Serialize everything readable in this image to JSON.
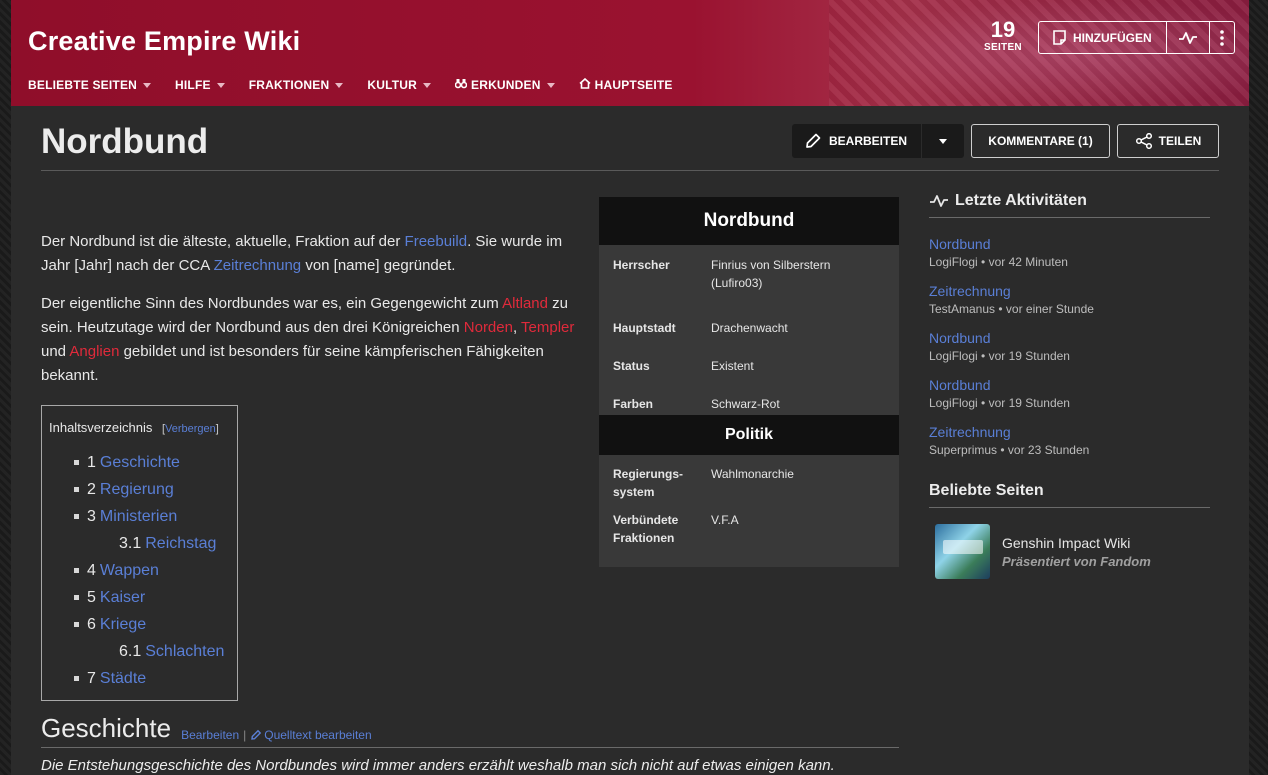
{
  "header": {
    "site_title": "Creative Empire Wiki",
    "nav": [
      {
        "label": "BELIEBTE SEITEN",
        "caret": true
      },
      {
        "label": "HILFE",
        "caret": true
      },
      {
        "label": "FRAKTIONEN",
        "caret": true
      },
      {
        "label": "KULTUR",
        "caret": true
      },
      {
        "label": "ERKUNDEN",
        "caret": true,
        "icon": "binoculars-icon"
      },
      {
        "label": "HAUPTSEITE",
        "caret": false,
        "icon": "home-icon"
      }
    ],
    "pages_count": "19",
    "pages_label": "SEITEN",
    "add_label": "HINZUFÜGEN"
  },
  "page": {
    "title": "Nordbund",
    "edit_label": "BEARBEITEN",
    "comments_label": "KOMMENTARE (1)",
    "share_label": "TEILEN"
  },
  "article": {
    "p1": {
      "a": "Der Nordbund ist die älteste, aktuelle, Fraktion auf der ",
      "link1": "Freebuild",
      "b": ". Sie wurde im Jahr [Jahr] nach der CCA ",
      "link2": "Zeitrechnung",
      "c": " von [name] gegründet."
    },
    "p2": {
      "a": "Der eigentliche Sinn des Nordbundes war es, ein Gegengewicht zum ",
      "link1": "Altland",
      "b": " zu sein. Heutzutage wird der Nordbund aus den drei Königreichen ",
      "link2": "Norden",
      "c": ", ",
      "link3": "Templer",
      "d": " und ",
      "link4": "Anglien",
      "e": " gebildet und ist besonders für seine kämpferischen Fähigkeiten bekannt."
    }
  },
  "toc": {
    "title": "Inhaltsverzeichnis",
    "toggle_open": "[",
    "toggle_label": "Verbergen",
    "toggle_close": "]",
    "items": [
      {
        "num": "1",
        "label": "Geschichte",
        "sub": false
      },
      {
        "num": "2",
        "label": "Regierung",
        "sub": false
      },
      {
        "num": "3",
        "label": "Ministerien",
        "sub": false
      },
      {
        "num": "3.1",
        "label": "Reichstag",
        "sub": true
      },
      {
        "num": "4",
        "label": "Wappen",
        "sub": false
      },
      {
        "num": "5",
        "label": "Kaiser",
        "sub": false
      },
      {
        "num": "6",
        "label": "Kriege",
        "sub": false
      },
      {
        "num": "6.1",
        "label": "Schlachten",
        "sub": true
      },
      {
        "num": "7",
        "label": "Städte",
        "sub": false
      }
    ]
  },
  "section": {
    "heading": "Geschichte",
    "edit": "Bearbeiten",
    "separator": "|",
    "source_edit": "Quelltext bearbeiten",
    "intro": "Die Entstehungsgeschichte des Nordbundes wird immer anders erzählt weshalb man sich nicht auf etwas einigen kann."
  },
  "infobox": {
    "title": "Nordbund",
    "rows": [
      {
        "key": "Herrscher",
        "value": "Finrius von Silberstern (Lufiro03)"
      },
      {
        "key": "Hauptstadt",
        "value": "Drachenwacht"
      },
      {
        "key": "Status",
        "value": "Existent"
      },
      {
        "key": "Farben",
        "value": "Schwarz-Rot"
      }
    ],
    "section2": "Politik",
    "rows2": [
      {
        "key": "Regierungs-system",
        "value": "Wahlmonarchie"
      },
      {
        "key": "Verbündete Fraktionen",
        "value": "V.F.A"
      }
    ]
  },
  "rail": {
    "activity_title": "Letzte Aktivitäten",
    "activities": [
      {
        "title": "Nordbund",
        "meta": "LogiFlogi • vor 42 Minuten"
      },
      {
        "title": "Zeitrechnung",
        "meta": "TestAmanus • vor einer Stunde"
      },
      {
        "title": "Nordbund",
        "meta": "LogiFlogi • vor 19 Stunden"
      },
      {
        "title": "Nordbund",
        "meta": "LogiFlogi • vor 19 Stunden"
      },
      {
        "title": "Zeitrechnung",
        "meta": "Superprimus • vor 23 Stunden"
      }
    ],
    "popular_title": "Beliebte Seiten",
    "popular": [
      {
        "title": "Genshin Impact Wiki",
        "sub": "Präsentiert von Fandom"
      }
    ]
  },
  "colors": {
    "brand": "#8f0e2a",
    "link": "#5a7fd6",
    "redlink": "#e02a3b",
    "panel": "#2b2b2b"
  }
}
